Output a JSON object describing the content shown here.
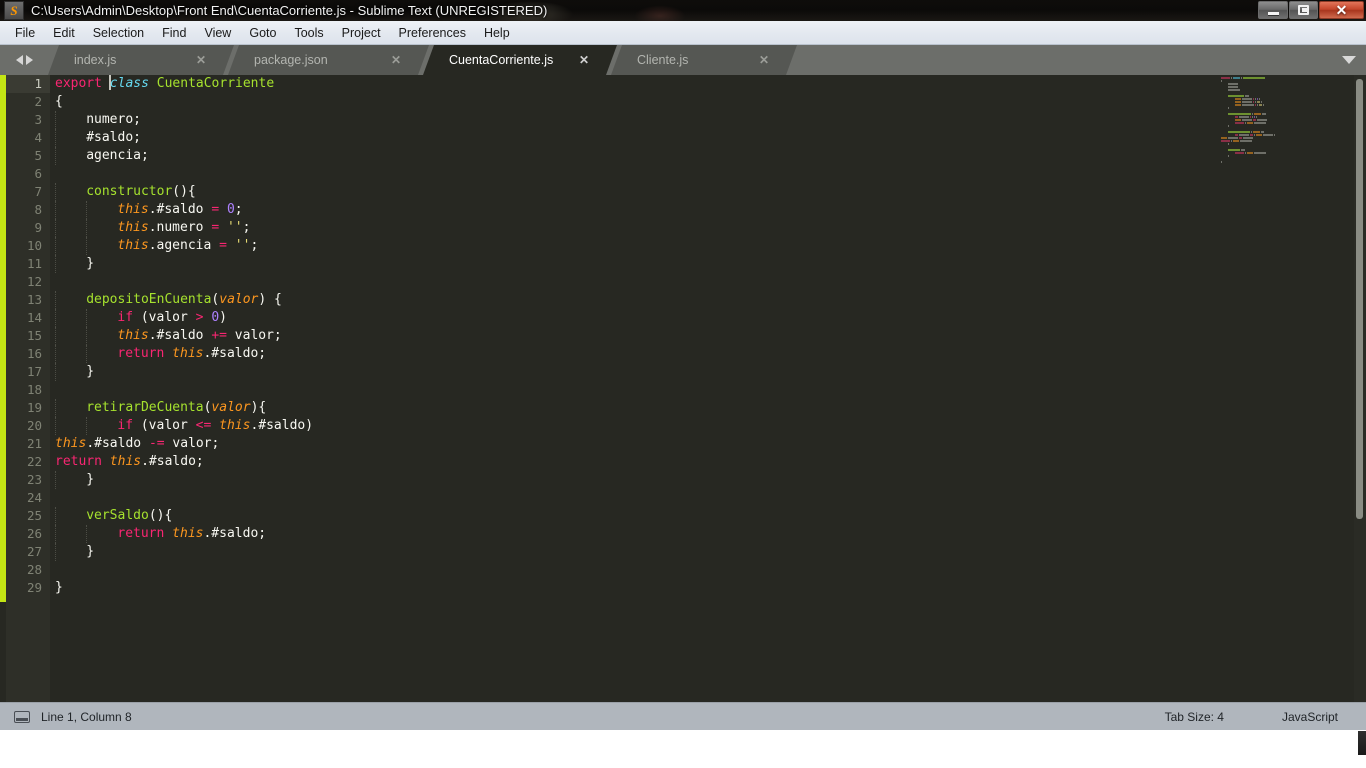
{
  "window": {
    "title": "C:\\Users\\Admin\\Desktop\\Front End\\CuentaCorriente.js - Sublime Text (UNREGISTERED)",
    "app_icon_glyph": "S",
    "controls": {
      "minimize_label": "—",
      "restore_label": "❐",
      "close_label": "✕"
    }
  },
  "menu": {
    "items": [
      {
        "label": "File"
      },
      {
        "label": "Edit"
      },
      {
        "label": "Selection"
      },
      {
        "label": "Find"
      },
      {
        "label": "View"
      },
      {
        "label": "Goto"
      },
      {
        "label": "Tools"
      },
      {
        "label": "Project"
      },
      {
        "label": "Preferences"
      },
      {
        "label": "Help"
      }
    ]
  },
  "tabbar": {
    "nav_prev_icon": "triangle-left-icon",
    "nav_next_icon": "triangle-right-icon",
    "dropdown_icon": "chevron-down-icon",
    "close_glyph": "✕",
    "tabs": [
      {
        "label": "index.js",
        "active": false
      },
      {
        "label": "package.json",
        "active": false
      },
      {
        "label": "CuentaCorriente.js",
        "active": true
      },
      {
        "label": "Cliente.js",
        "active": false
      }
    ]
  },
  "editor": {
    "language": "JavaScript",
    "cursor_line": 1,
    "cursor_column": 8,
    "total_lines": 29,
    "colors": {
      "background": "#272822",
      "gutter_background": "#2e2f28",
      "left_stripe": "#c3e514",
      "keyword": "#f92672",
      "class_name": "#66d9ef",
      "entity": "#a6e22e",
      "variable_special": "#fd971f",
      "number": "#ae81ff",
      "string": "#e6db74",
      "foreground": "#f8f8f2"
    },
    "line_numbers": [
      1,
      2,
      3,
      4,
      5,
      6,
      7,
      8,
      9,
      10,
      11,
      12,
      13,
      14,
      15,
      16,
      17,
      18,
      19,
      20,
      21,
      22,
      23,
      24,
      25,
      26,
      27,
      28,
      29
    ],
    "lines": [
      {
        "n": 1,
        "indent": 0,
        "tokens": [
          {
            "t": "keyword",
            "v": "export"
          },
          {
            "t": "plain",
            "v": " "
          },
          {
            "t": "cursor",
            "v": ""
          },
          {
            "t": "class",
            "v": "class"
          },
          {
            "t": "plain",
            "v": " "
          },
          {
            "t": "name",
            "v": "CuentaCorriente"
          }
        ]
      },
      {
        "n": 2,
        "indent": 0,
        "tokens": [
          {
            "t": "punct",
            "v": "{"
          }
        ]
      },
      {
        "n": 3,
        "indent": 1,
        "tokens": [
          {
            "t": "plain",
            "v": "numero;"
          }
        ]
      },
      {
        "n": 4,
        "indent": 1,
        "tokens": [
          {
            "t": "plain",
            "v": "#saldo;"
          }
        ]
      },
      {
        "n": 5,
        "indent": 1,
        "tokens": [
          {
            "t": "plain",
            "v": "agencia;"
          }
        ]
      },
      {
        "n": 6,
        "indent": 0,
        "tokens": []
      },
      {
        "n": 7,
        "indent": 1,
        "tokens": [
          {
            "t": "fn",
            "v": "constructor"
          },
          {
            "t": "punct",
            "v": "(){"
          }
        ]
      },
      {
        "n": 8,
        "indent": 2,
        "tokens": [
          {
            "t": "this",
            "v": "this"
          },
          {
            "t": "plain",
            "v": ".#saldo "
          },
          {
            "t": "op",
            "v": "="
          },
          {
            "t": "plain",
            "v": " "
          },
          {
            "t": "num",
            "v": "0"
          },
          {
            "t": "punct",
            "v": ";"
          }
        ]
      },
      {
        "n": 9,
        "indent": 2,
        "tokens": [
          {
            "t": "this",
            "v": "this"
          },
          {
            "t": "plain",
            "v": ".numero "
          },
          {
            "t": "op",
            "v": "="
          },
          {
            "t": "plain",
            "v": " "
          },
          {
            "t": "str",
            "v": "''"
          },
          {
            "t": "punct",
            "v": ";"
          }
        ]
      },
      {
        "n": 10,
        "indent": 2,
        "tokens": [
          {
            "t": "this",
            "v": "this"
          },
          {
            "t": "plain",
            "v": ".agencia "
          },
          {
            "t": "op",
            "v": "="
          },
          {
            "t": "plain",
            "v": " "
          },
          {
            "t": "str",
            "v": "''"
          },
          {
            "t": "punct",
            "v": ";"
          }
        ]
      },
      {
        "n": 11,
        "indent": 1,
        "tokens": [
          {
            "t": "punct",
            "v": "}"
          }
        ]
      },
      {
        "n": 12,
        "indent": 0,
        "tokens": []
      },
      {
        "n": 13,
        "indent": 1,
        "tokens": [
          {
            "t": "fn",
            "v": "depositoEnCuenta"
          },
          {
            "t": "punct",
            "v": "("
          },
          {
            "t": "param",
            "v": "valor"
          },
          {
            "t": "punct",
            "v": ") {"
          }
        ]
      },
      {
        "n": 14,
        "indent": 2,
        "tokens": [
          {
            "t": "keyword",
            "v": "if"
          },
          {
            "t": "plain",
            "v": " (valor "
          },
          {
            "t": "op",
            "v": ">"
          },
          {
            "t": "plain",
            "v": " "
          },
          {
            "t": "num",
            "v": "0"
          },
          {
            "t": "punct",
            "v": ")"
          }
        ]
      },
      {
        "n": 15,
        "indent": 2,
        "tokens": [
          {
            "t": "this",
            "v": "this"
          },
          {
            "t": "plain",
            "v": ".#saldo "
          },
          {
            "t": "op",
            "v": "+="
          },
          {
            "t": "plain",
            "v": " valor;"
          }
        ]
      },
      {
        "n": 16,
        "indent": 2,
        "tokens": [
          {
            "t": "keyword",
            "v": "return"
          },
          {
            "t": "plain",
            "v": " "
          },
          {
            "t": "this",
            "v": "this"
          },
          {
            "t": "plain",
            "v": ".#saldo;"
          }
        ]
      },
      {
        "n": 17,
        "indent": 1,
        "tokens": [
          {
            "t": "punct",
            "v": "}"
          }
        ]
      },
      {
        "n": 18,
        "indent": 0,
        "tokens": []
      },
      {
        "n": 19,
        "indent": 1,
        "tokens": [
          {
            "t": "fn",
            "v": "retirarDeCuenta"
          },
          {
            "t": "punct",
            "v": "("
          },
          {
            "t": "param",
            "v": "valor"
          },
          {
            "t": "punct",
            "v": "){"
          }
        ]
      },
      {
        "n": 20,
        "indent": 2,
        "tokens": [
          {
            "t": "keyword",
            "v": "if"
          },
          {
            "t": "plain",
            "v": " (valor "
          },
          {
            "t": "op",
            "v": "<="
          },
          {
            "t": "plain",
            "v": " "
          },
          {
            "t": "this",
            "v": "this"
          },
          {
            "t": "plain",
            "v": ".#saldo"
          },
          {
            "t": "punct",
            "v": ")"
          }
        ]
      },
      {
        "n": 21,
        "indent": 0,
        "tokens": [
          {
            "t": "this",
            "v": "this"
          },
          {
            "t": "plain",
            "v": ".#saldo "
          },
          {
            "t": "op",
            "v": "-="
          },
          {
            "t": "plain",
            "v": " valor;"
          }
        ]
      },
      {
        "n": 22,
        "indent": 0,
        "tokens": [
          {
            "t": "keyword",
            "v": "return"
          },
          {
            "t": "plain",
            "v": " "
          },
          {
            "t": "this",
            "v": "this"
          },
          {
            "t": "plain",
            "v": ".#saldo;"
          }
        ]
      },
      {
        "n": 23,
        "indent": 1,
        "tokens": [
          {
            "t": "punct",
            "v": "}"
          }
        ]
      },
      {
        "n": 24,
        "indent": 0,
        "tokens": []
      },
      {
        "n": 25,
        "indent": 1,
        "tokens": [
          {
            "t": "fn",
            "v": "verSaldo"
          },
          {
            "t": "punct",
            "v": "(){"
          }
        ]
      },
      {
        "n": 26,
        "indent": 2,
        "tokens": [
          {
            "t": "keyword",
            "v": "return"
          },
          {
            "t": "plain",
            "v": " "
          },
          {
            "t": "this",
            "v": "this"
          },
          {
            "t": "plain",
            "v": ".#saldo;"
          }
        ]
      },
      {
        "n": 27,
        "indent": 1,
        "tokens": [
          {
            "t": "punct",
            "v": "}"
          }
        ]
      },
      {
        "n": 28,
        "indent": 0,
        "tokens": []
      },
      {
        "n": 29,
        "indent": 0,
        "tokens": [
          {
            "t": "punct",
            "v": "}"
          }
        ]
      }
    ]
  },
  "statusbar": {
    "icon": "panel-icon",
    "position": "Line 1, Column 8",
    "tab_size": "Tab Size: 4",
    "syntax": "JavaScript"
  }
}
